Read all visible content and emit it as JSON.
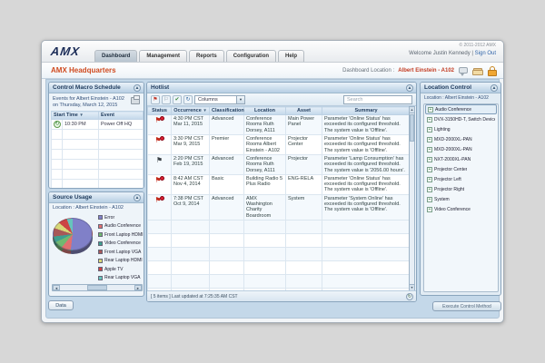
{
  "header": {
    "logo": "AMX",
    "tabs": [
      "Dashboard",
      "Management",
      "Reports",
      "Configuration",
      "Help"
    ],
    "copyright": "© 2011-2012 AMX",
    "welcome": "Welcome Justin Kennedy",
    "sign_out": "Sign Out",
    "page_title": "AMX Headquarters",
    "dashboard_location_label": "Dashboard Location :",
    "dashboard_location_value": "Albert Einstein - A102"
  },
  "schedule": {
    "title": "Control Macro Schedule",
    "events_line1": "Events for Albert Einstein - A102",
    "events_line2": "on Thursday, March 12, 2015",
    "columns": {
      "start_time": "Start Time",
      "event": "Event"
    },
    "rows": [
      {
        "time": "10:30 PM",
        "event": "Power Off HQ"
      }
    ]
  },
  "source_usage": {
    "title": "Source Usage",
    "location": "Location :  Albert Einstein - A102",
    "data_button": "Data",
    "chart_data": {
      "type": "pie",
      "title": "Source Usage",
      "categories": [
        "Error",
        "Audio Conference",
        "Front Laptop HDMI",
        "Video Conference",
        "Front Laptop VGA",
        "Rear Laptop HDMI",
        "Apple TV",
        "Rear Laptop VGA"
      ],
      "values": [
        52,
        9,
        7,
        5,
        7,
        6,
        8,
        6
      ],
      "unit": "percent",
      "colors": [
        "#8080c8",
        "#e07070",
        "#70b870",
        "#3f9f8f",
        "#a85858",
        "#d8d878",
        "#cc4444",
        "#66c4bc"
      ],
      "legend_position": "right"
    }
  },
  "hotlist": {
    "title": "Hotlist",
    "toolbar": {
      "columns_dropdown": "Columns",
      "search_placeholder": "Search"
    },
    "columns": [
      "Status",
      "Occurrence",
      "Classification",
      "Location",
      "Asset",
      "Summary"
    ],
    "rows": [
      {
        "status": "offline",
        "time": "4:30 PM CST",
        "date": "Mar 11, 2015",
        "classification": "Advanced",
        "location": "Conference Rooms Ruth Dorsey, A111",
        "asset": "Main Power Panel",
        "summary": "Parameter 'Online Status' has exceeded its configured threshold. The system value is 'Offline'."
      },
      {
        "status": "offline",
        "time": "3:30 PM CST",
        "date": "Mar 9, 2015",
        "classification": "Premier",
        "location": "Conference Rooms Albert Einstein - A102",
        "asset": "Projector Center",
        "summary": "Parameter 'Online Status' has exceeded its configured threshold. The system value is 'Offline'."
      },
      {
        "status": "threshold",
        "time": "2:20 PM CST",
        "date": "Feb 19, 2015",
        "classification": "Advanced",
        "location": "Conference Rooms Ruth Dorsey, A111",
        "asset": "Projector",
        "summary": "Parameter 'Lamp Consumption' has exceeded its configured threshold. The system value is '2056.00 hours'."
      },
      {
        "status": "offline",
        "time": "8:42 AM CST",
        "date": "Nov 4, 2014",
        "classification": "Basic",
        "location": "Building Radio 5 Plus Radio",
        "asset": "ENG-RELA",
        "summary": "Parameter 'Online Status' has exceeded its configured threshold. The system value is 'Offline'."
      },
      {
        "status": "offline",
        "time": "7:38 PM CST",
        "date": "Oct 9, 2014",
        "classification": "Advanced",
        "location": "AMX Washington Charity Boardroom",
        "asset": "System",
        "summary": "Parameter 'System Online' has exceeded its configured threshold. The system value is 'Offline'."
      }
    ],
    "status_bar": "[ 5 items ]   Last updated at 7:25:35 AM CST"
  },
  "location_control": {
    "title": "Location Control",
    "location": "Location :  Albert Einstein - A102",
    "items": [
      "Audio Conference",
      "DVX-3150HD-T, Switch Device",
      "Lighting",
      "MXD-2000XL-PAN",
      "MXD-2000XL-PAN",
      "NXT-2000XL-PAN",
      "Projector Center",
      "Projector Left",
      "Projector Right",
      "System",
      "Video Conference"
    ],
    "execute_button": "Execute Control Method"
  },
  "icons": {
    "toolbar_glyphs": [
      "⚑",
      "⚐",
      "✔",
      "↻"
    ],
    "collapse_glyph": "▲",
    "sort_glyph": "▼",
    "recurrence_glyph": "↻",
    "tree_expand_glyph": "+"
  }
}
